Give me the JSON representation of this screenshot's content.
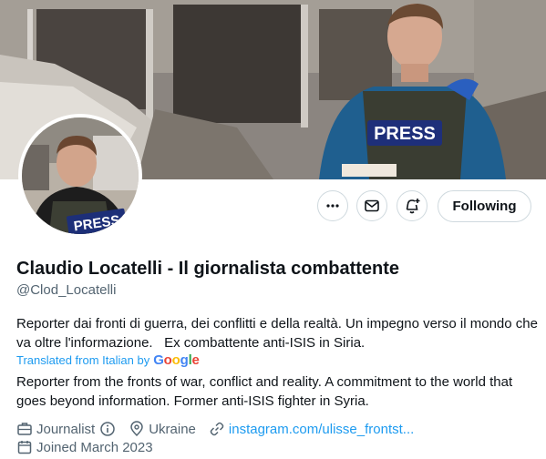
{
  "profile": {
    "display_name": "Claudio Locatelli - Il giornalista combattente",
    "handle": "@Clod_Locatelli",
    "bio_original": "Reporter dai fronti di guerra, dei conflitti e della realtà. Un impegno verso il mondo che va oltre l'informazione.   Ex combattente anti-ISIS in Siria.",
    "translated_label": "Translated from Italian by",
    "translator": "Google",
    "bio_translated": "Reporter from the fronts of war, conflict and reality. A commitment to the world that goes beyond information. Former anti-ISIS fighter in Syria.",
    "banner_press_text": "PRESS",
    "avatar_press_text": "PRESS"
  },
  "actions": {
    "follow_label": "Following"
  },
  "meta": {
    "profession": "Journalist",
    "location": "Ukraine",
    "website": "instagram.com/ulisse_frontst...",
    "joined": "Joined March 2023"
  },
  "icons": [
    "more-icon",
    "message-icon",
    "notify-icon",
    "briefcase-icon",
    "info-icon",
    "location-icon",
    "link-icon",
    "calendar-icon"
  ],
  "colors": {
    "accent": "#1d9bf0",
    "text": "#0f1419",
    "muted": "#536471",
    "border": "#cfd9de"
  }
}
